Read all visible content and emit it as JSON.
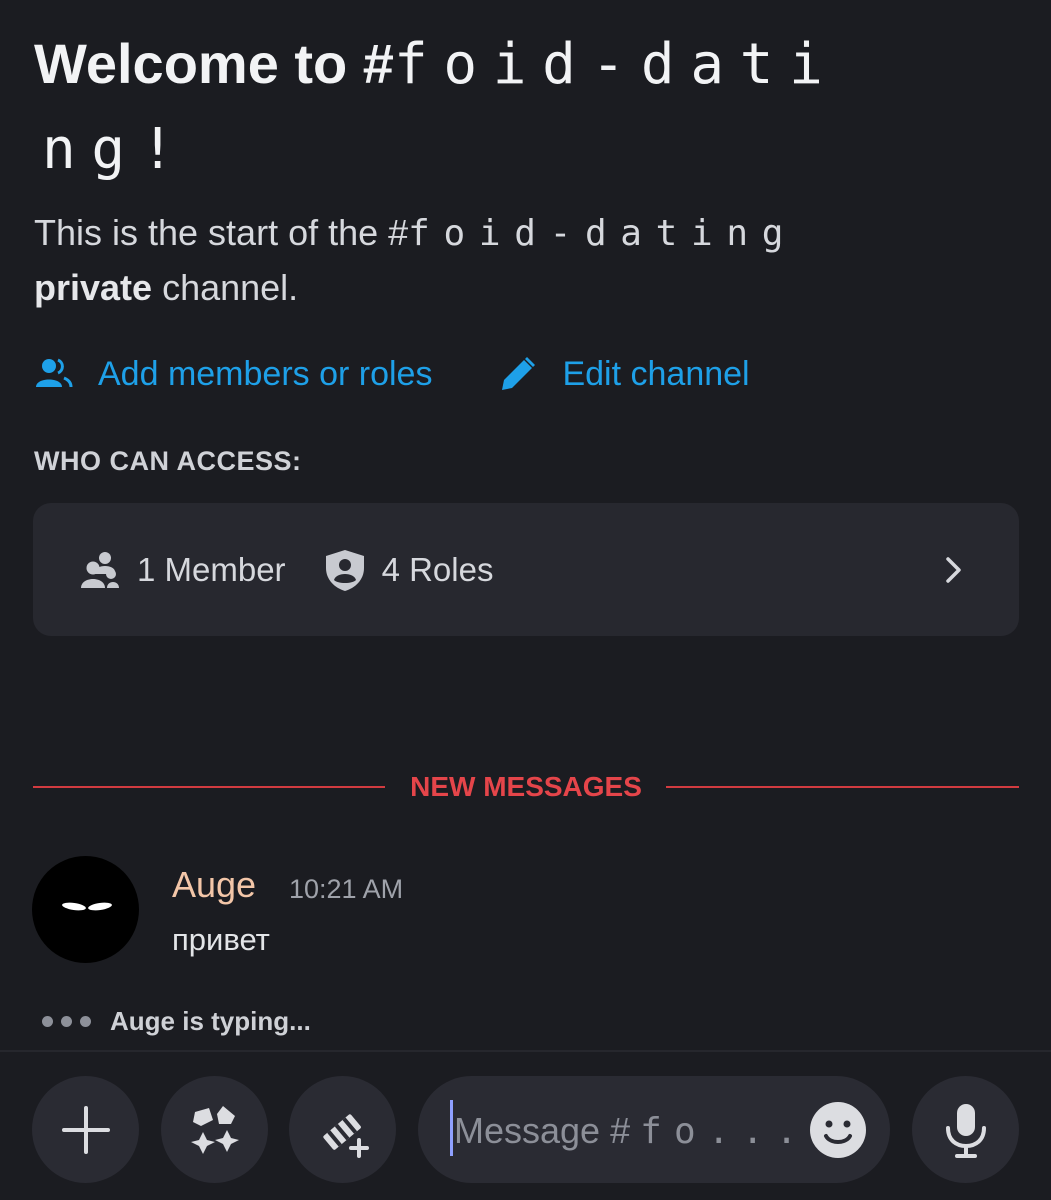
{
  "welcome": {
    "title_prefix": "Welcome to #",
    "channel_name_line1": "foid-dati",
    "channel_name_line2": "ng!",
    "sub_prefix": "This is the start of the #",
    "sub_channel_name": "foid-dating",
    "sub_bold": "private",
    "sub_suffix": " channel."
  },
  "actions": {
    "add_members_label": "Add members or roles",
    "edit_channel_label": "Edit channel"
  },
  "access": {
    "heading": "WHO CAN ACCESS:",
    "members_label": "1 Member",
    "roles_label": "4 Roles"
  },
  "divider": {
    "label": "NEW MESSAGES"
  },
  "message": {
    "author": "Auge",
    "time": "10:21 AM",
    "text": "привет"
  },
  "typing": {
    "text": "Auge is typing..."
  },
  "composer": {
    "placeholder_prefix": "Message #",
    "placeholder_channel": "fo...",
    "icons": [
      "plus-icon",
      "apps-icon",
      "gift-icon",
      "emoji-icon",
      "microphone-icon"
    ]
  },
  "colors": {
    "background": "#1b1c21",
    "link": "#1ea0e8",
    "new_messages": "#e5454a",
    "author": "#f3c6a8"
  }
}
